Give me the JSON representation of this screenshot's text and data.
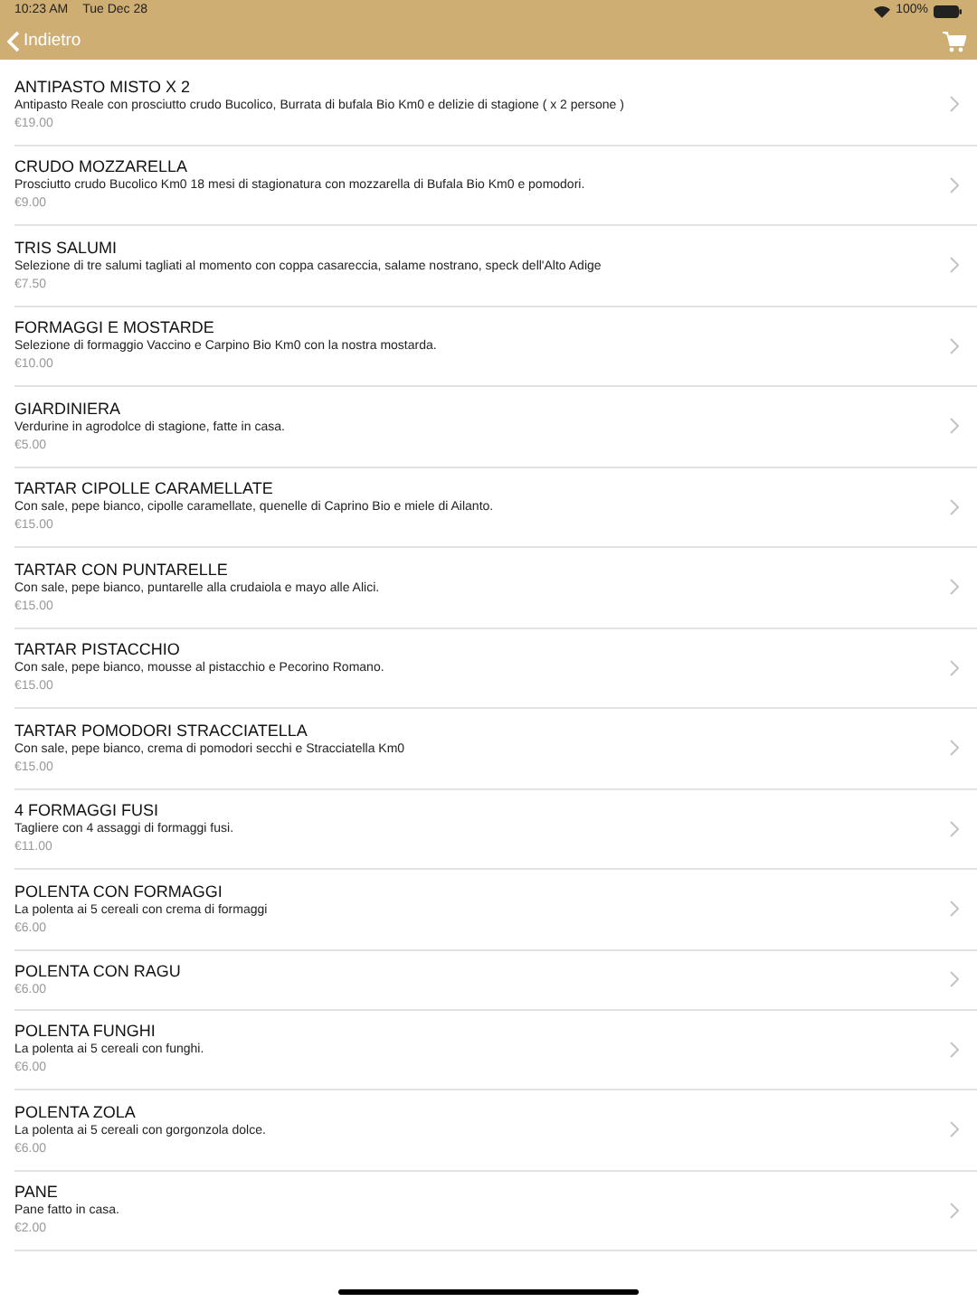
{
  "status_bar": {
    "time": "10:23 AM",
    "date": "Tue Dec 28",
    "battery": "100%"
  },
  "nav_bar": {
    "back_label": "Indietro"
  },
  "items": [
    {
      "name": "ANTIPASTO MISTO X 2",
      "description": "Antipasto Reale con prosciutto crudo Bucolico, Burrata di bufala Bio Km0 e delizie di stagione ( x 2 persone )",
      "price": "€19.00"
    },
    {
      "name": "CRUDO MOZZARELLA",
      "description": "Prosciutto crudo Bucolico Km0 18 mesi di stagionatura con mozzarella di Bufala Bio Km0 e pomodori.",
      "price": "€9.00"
    },
    {
      "name": "TRIS SALUMI",
      "description": "Selezione di tre salumi tagliati al momento con coppa casareccia, salame nostrano, speck dell'Alto Adige",
      "price": "€7.50"
    },
    {
      "name": "FORMAGGI E MOSTARDE",
      "description": "Selezione di formaggio Vaccino e Carpino Bio Km0 con la nostra mostarda.",
      "price": "€10.00"
    },
    {
      "name": "GIARDINIERA",
      "description": "Verdurine in agrodolce di stagione, fatte in casa.",
      "price": "€5.00"
    },
    {
      "name": "TARTAR CIPOLLE CARAMELLATE",
      "description": "Con sale, pepe bianco, cipolle caramellate, quenelle di Caprino Bio e miele di Ailanto.",
      "price": "€15.00"
    },
    {
      "name": "TARTAR CON PUNTARELLE",
      "description": "Con sale, pepe bianco, puntarelle alla crudaiola e mayo alle Alici.",
      "price": "€15.00"
    },
    {
      "name": "TARTAR PISTACCHIO",
      "description": "Con sale, pepe bianco, mousse al pistacchio e Pecorino Romano.",
      "price": "€15.00"
    },
    {
      "name": "TARTAR POMODORI STRACCIATELLA",
      "description": "Con sale, pepe bianco, crema di pomodori secchi e Stracciatella Km0",
      "price": "€15.00"
    },
    {
      "name": "4 FORMAGGI FUSI",
      "description": "Tagliere con 4 assaggi di formaggi fusi.",
      "price": "€11.00"
    },
    {
      "name": "POLENTA CON FORMAGGI",
      "description": "La polenta ai 5 cereali con crema di formaggi",
      "price": "€6.00"
    },
    {
      "name": "POLENTA CON RAGU",
      "price": "€6.00"
    },
    {
      "name": "POLENTA FUNGHI",
      "description": "La polenta ai 5 cereali con funghi.",
      "price": "€6.00"
    },
    {
      "name": "POLENTA ZOLA",
      "description": "La polenta ai 5 cereali con gorgonzola dolce.",
      "price": "€6.00"
    },
    {
      "name": "PANE",
      "description": "Pane fatto in casa.",
      "price": "€2.00"
    }
  ]
}
